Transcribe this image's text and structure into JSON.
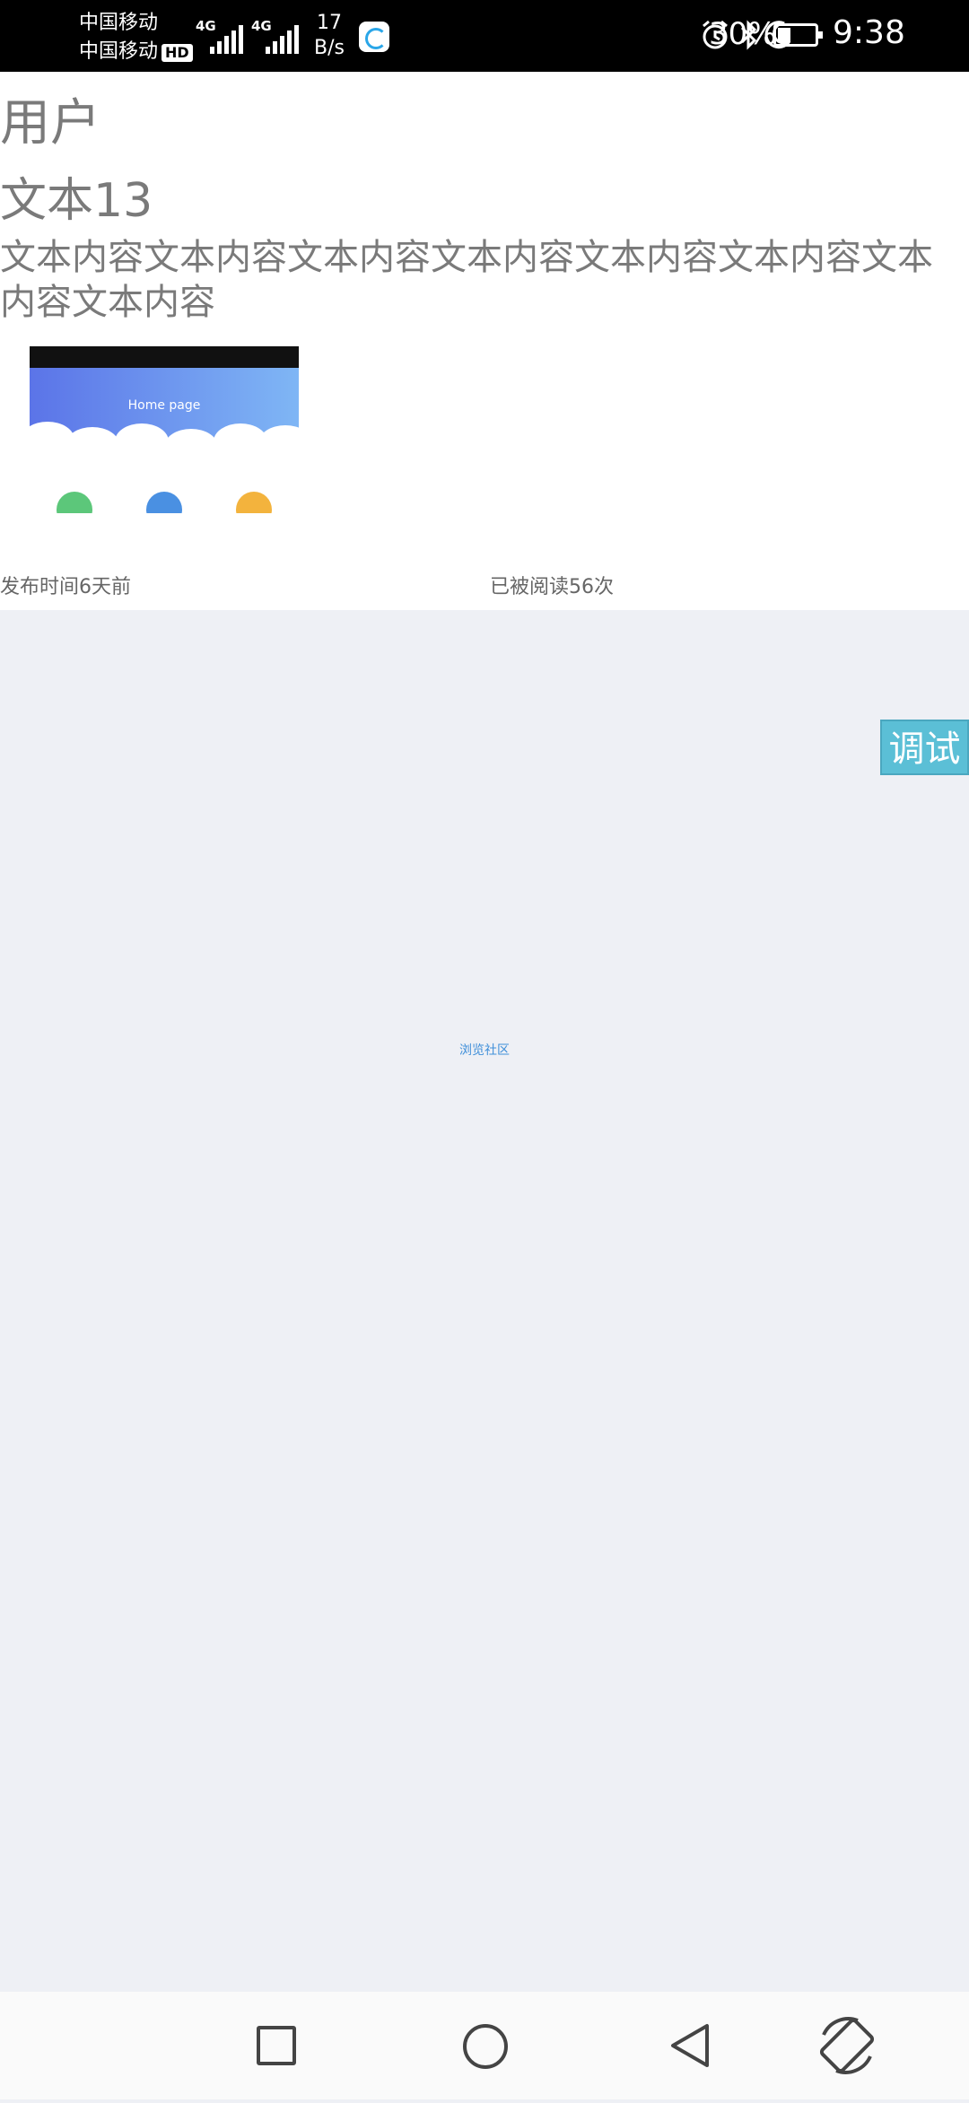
{
  "status_bar": {
    "carrier1": "中国移动",
    "carrier2": "中国移动",
    "hd_badge": "HD",
    "signal1_tag": "4G",
    "signal2_tag": "4G",
    "net_speed_value": "17",
    "net_speed_unit": "B/s",
    "battery_percent": "30%",
    "time": "9:38"
  },
  "post": {
    "user": "用户",
    "title": "文本13",
    "content": "文本内容文本内容文本内容文本内容文本内容文本内容文本内容文本内容",
    "thumbnail": {
      "page_title": "Home page",
      "circle_colors": [
        "#5cc77a",
        "#4a90e2",
        "#f3b33d"
      ]
    },
    "published": "发布时间6天前",
    "read_count": "已被阅读56次"
  },
  "empty_label": "浏览社区",
  "debug_button": "调试",
  "nav": {
    "recent_icon": "square-icon",
    "home_icon": "circle-icon",
    "back_icon": "triangle-back-icon",
    "rotate_icon": "rotate-icon"
  }
}
